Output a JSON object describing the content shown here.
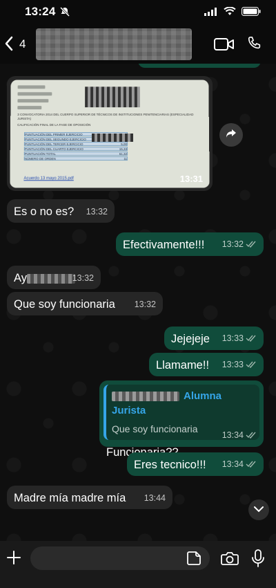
{
  "status": {
    "time": "13:24"
  },
  "header": {
    "back_count": "4"
  },
  "image_message": {
    "time": "13:31",
    "doc_header_title": "3 CONVOCATORIA 2014 DEL CUERPO SUPERIOR DE TÉCNICOS DE INSTITUCIONES PENITENCIARIAS (ESPECIALIDAD JURISTA)",
    "doc_subtitle": "CALIFICACIÓN FINAL DE LA FASE DE OPOSICIÓN",
    "doc_rows": [
      {
        "label": "PUNTUACIÓN DEL PRIMER EJERCICIO",
        "value": ""
      },
      {
        "label": "PUNTUACIÓN DEL SEGUNDO EJERCICIO",
        "value": "15,57"
      },
      {
        "label": "PUNTUACIÓN DEL TERCER EJERCICIO",
        "value": "5,00"
      },
      {
        "label": "PUNTUACIÓN DEL CUARTO EJERCICIO",
        "value": "15,33"
      },
      {
        "label": "PUNTUACIÓN TOTAL",
        "value": "61,32"
      },
      {
        "label": "NÚMERO DE ORDEN",
        "value": "11"
      }
    ],
    "doc_attachment": "Acuerdo 13 mayo 2015.pdf"
  },
  "messages": [
    {
      "text": "Es o no es?",
      "time": "13:32"
    },
    {
      "text": "Efectivamente!!!",
      "time": "13:32"
    },
    {
      "text": "Ay",
      "time": "13:32"
    },
    {
      "text": "Que soy funcionaria",
      "time": "13:32"
    },
    {
      "text": "Jejejeje",
      "time": "13:33"
    },
    {
      "text": "Llamame!!",
      "time": "13:33"
    },
    {
      "reply_name": "Alumna Jurista",
      "reply_text": "Que soy funcionaria",
      "text": "Funcionaria??",
      "time": "13:34"
    },
    {
      "text": "Eres tecnico!!!",
      "time": "13:34"
    },
    {
      "text": "Madre mía madre mía",
      "time": "13:44"
    }
  ],
  "colors": {
    "outgoing": "#104c3b",
    "incoming": "#262626",
    "reply_accent": "#35a5e8",
    "read_ticks": "#9fb7ad"
  },
  "icons": [
    "bell-off-icon",
    "signal-icon",
    "wifi-icon",
    "battery-icon",
    "back-chevron-icon",
    "video-call-icon",
    "phone-icon",
    "share-icon",
    "chevron-down-icon",
    "plus-icon",
    "sticker-icon",
    "camera-icon",
    "mic-icon"
  ]
}
